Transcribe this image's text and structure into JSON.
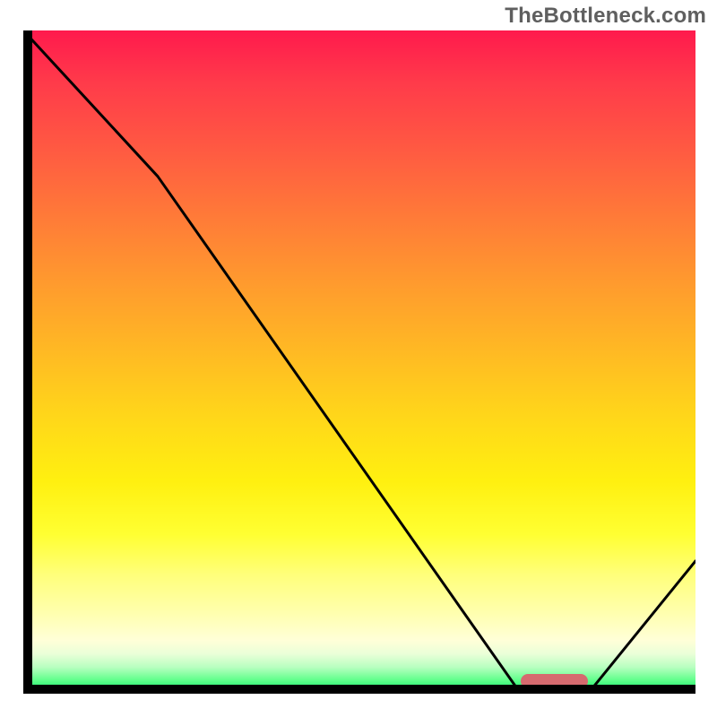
{
  "watermark": "TheBottleneck.com",
  "chart_data": {
    "type": "line",
    "title": "",
    "xlabel": "",
    "ylabel": "",
    "xlim": [
      0,
      100
    ],
    "ylim": [
      0,
      100
    ],
    "x": [
      0,
      20,
      74,
      84,
      100
    ],
    "values": [
      100,
      78,
      0,
      0,
      20
    ],
    "minimum_region": {
      "x_start": 74,
      "x_end": 84,
      "bar_color": "#d66a6f"
    },
    "background_gradient": {
      "orientation": "vertical",
      "stops": [
        {
          "pos": 0.0,
          "color": "#ff1a4d"
        },
        {
          "pos": 0.5,
          "color": "#ffb824"
        },
        {
          "pos": 0.78,
          "color": "#ffff32"
        },
        {
          "pos": 1.0,
          "color": "#00e060"
        }
      ]
    },
    "grid": false,
    "legend": false
  },
  "colors": {
    "curve": "#000000",
    "axis": "#000000",
    "watermark": "#5f5f5f",
    "minimum_bar": "#d66a6f"
  }
}
